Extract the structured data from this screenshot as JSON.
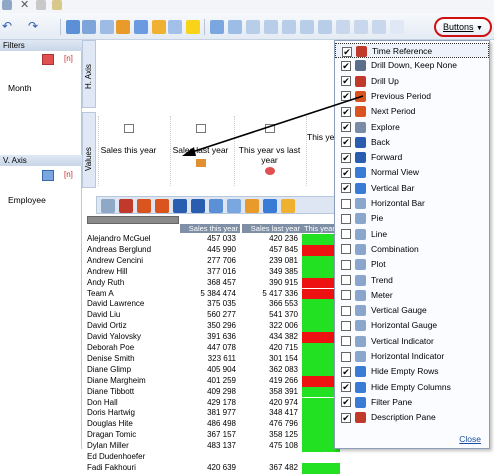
{
  "toolbar": {
    "buttons_label": "Buttons"
  },
  "left": {
    "filters_label": "Filters",
    "filter_marker": "[n]",
    "month_label": "Month",
    "vaxis_label": "V. Axis",
    "vaxis_marker": "[n]",
    "employee_label": "Employee"
  },
  "main": {
    "haxis_label": "H. Axis",
    "values_label": "Values",
    "value_fields": [
      "Sales this year",
      "Sales last year",
      "This year vs last year",
      "This year ..."
    ],
    "grid_headers": [
      "Sales this year",
      "Sales last year",
      "This year"
    ],
    "rows": [
      {
        "name": "Alejandro McGuel",
        "c1": "457 033",
        "c2": "420 236",
        "flag": "green"
      },
      {
        "name": "Andreas Berglund",
        "c1": "445 990",
        "c2": "457 845",
        "flag": "red"
      },
      {
        "name": "Andrew Cencini",
        "c1": "277 706",
        "c2": "239 081",
        "flag": "green"
      },
      {
        "name": "Andrew Hill",
        "c1": "377 016",
        "c2": "349 385",
        "flag": "green"
      },
      {
        "name": "Andy Ruth",
        "c1": "368 457",
        "c2": "390 915",
        "flag": "red"
      },
      {
        "name": "Team A",
        "c1": "5 384 474",
        "c2": "5 417 336",
        "flag": "red"
      },
      {
        "name": "David Lawrence",
        "c1": "375 035",
        "c2": "366 553",
        "flag": "green"
      },
      {
        "name": "David Liu",
        "c1": "560 277",
        "c2": "541 370",
        "flag": "green"
      },
      {
        "name": "David Ortiz",
        "c1": "350 296",
        "c2": "322 006",
        "flag": "green"
      },
      {
        "name": "David Yalovsky",
        "c1": "391 636",
        "c2": "434 382",
        "flag": "red"
      },
      {
        "name": "Deborah Poe",
        "c1": "447 078",
        "c2": "420 715",
        "flag": "green"
      },
      {
        "name": "Denise Smith",
        "c1": "323 611",
        "c2": "301 154",
        "flag": "green"
      },
      {
        "name": "Diane Glimp",
        "c1": "405 904",
        "c2": "362 083",
        "flag": "green"
      },
      {
        "name": "Diane Margheim",
        "c1": "401 259",
        "c2": "419 266",
        "flag": "red"
      },
      {
        "name": "Diane Tibbott",
        "c1": "409 298",
        "c2": "358 391",
        "flag": "green"
      },
      {
        "name": "Don Hall",
        "c1": "429 178",
        "c2": "420 974",
        "flag": "green"
      },
      {
        "name": "Doris Hartwig",
        "c1": "381 977",
        "c2": "348 417",
        "flag": "green"
      },
      {
        "name": "Douglas Hite",
        "c1": "486 498",
        "c2": "476 796",
        "flag": "green"
      },
      {
        "name": "Dragan Tomic",
        "c1": "367 157",
        "c2": "358 125",
        "flag": "green"
      },
      {
        "name": "Dylan Miller",
        "c1": "483 137",
        "c2": "475 108",
        "flag": "green"
      },
      {
        "name": "Ed Dudenhoefer",
        "c1": "",
        "c2": "",
        "flag": "none"
      },
      {
        "name": "Fadi Fakhouri",
        "c1": "420 639",
        "c2": "367 482",
        "flag": "green"
      }
    ]
  },
  "menu": {
    "items": [
      {
        "label": "Time Reference",
        "checked": true,
        "icon": "time-reference-icon",
        "color": "#c0392b"
      },
      {
        "label": "Drill Down, Keep None",
        "checked": true,
        "icon": "drill-down-icon",
        "color": "#5a6e8c"
      },
      {
        "label": "Drill Up",
        "checked": true,
        "icon": "drill-up-icon",
        "color": "#c0392b"
      },
      {
        "label": "Previous Period",
        "checked": true,
        "icon": "previous-period-icon",
        "color": "#d9541e"
      },
      {
        "label": "Next Period",
        "checked": true,
        "icon": "next-period-icon",
        "color": "#d9541e"
      },
      {
        "label": "Explore",
        "checked": true,
        "icon": "explore-icon",
        "color": "#7a8ba6"
      },
      {
        "label": "Back",
        "checked": true,
        "icon": "back-icon",
        "color": "#2a5db0"
      },
      {
        "label": "Forward",
        "checked": true,
        "icon": "forward-icon",
        "color": "#2a5db0"
      },
      {
        "label": "Normal View",
        "checked": true,
        "icon": "normal-view-icon",
        "color": "#3a7bd5"
      },
      {
        "label": "Vertical Bar",
        "checked": true,
        "icon": "vertical-bar-icon",
        "color": "#3a7bd5"
      },
      {
        "label": "Horizontal Bar",
        "checked": false,
        "icon": "horizontal-bar-icon",
        "color": "#8aa6cc"
      },
      {
        "label": "Pie",
        "checked": false,
        "icon": "pie-icon",
        "color": "#8aa6cc"
      },
      {
        "label": "Line",
        "checked": false,
        "icon": "line-icon",
        "color": "#8aa6cc"
      },
      {
        "label": "Combination",
        "checked": false,
        "icon": "combination-icon",
        "color": "#8aa6cc"
      },
      {
        "label": "Plot",
        "checked": false,
        "icon": "plot-icon",
        "color": "#8aa6cc"
      },
      {
        "label": "Trend",
        "checked": false,
        "icon": "trend-icon",
        "color": "#8aa6cc"
      },
      {
        "label": "Meter",
        "checked": false,
        "icon": "meter-icon",
        "color": "#8aa6cc"
      },
      {
        "label": "Vertical Gauge",
        "checked": false,
        "icon": "vertical-gauge-icon",
        "color": "#8aa6cc"
      },
      {
        "label": "Horizontal Gauge",
        "checked": false,
        "icon": "horizontal-gauge-icon",
        "color": "#8aa6cc"
      },
      {
        "label": "Vertical Indicator",
        "checked": false,
        "icon": "vertical-indicator-icon",
        "color": "#8aa6cc"
      },
      {
        "label": "Horizontal Indicator",
        "checked": false,
        "icon": "horizontal-indicator-icon",
        "color": "#8aa6cc"
      },
      {
        "label": "Hide Empty Rows",
        "checked": true,
        "icon": "hide-empty-rows-icon",
        "color": "#3a7bd5"
      },
      {
        "label": "Hide Empty Columns",
        "checked": true,
        "icon": "hide-empty-columns-icon",
        "color": "#3a7bd5"
      },
      {
        "label": "Filter Pane",
        "checked": true,
        "icon": "filter-pane-icon",
        "color": "#3a7bd5"
      },
      {
        "label": "Description Pane",
        "checked": true,
        "icon": "description-pane-icon",
        "color": "#c0392b"
      }
    ],
    "close_label": "Close"
  },
  "colors": {
    "green": "#22e022",
    "red": "#ee1111",
    "header_bg": "#7f8fa6"
  }
}
